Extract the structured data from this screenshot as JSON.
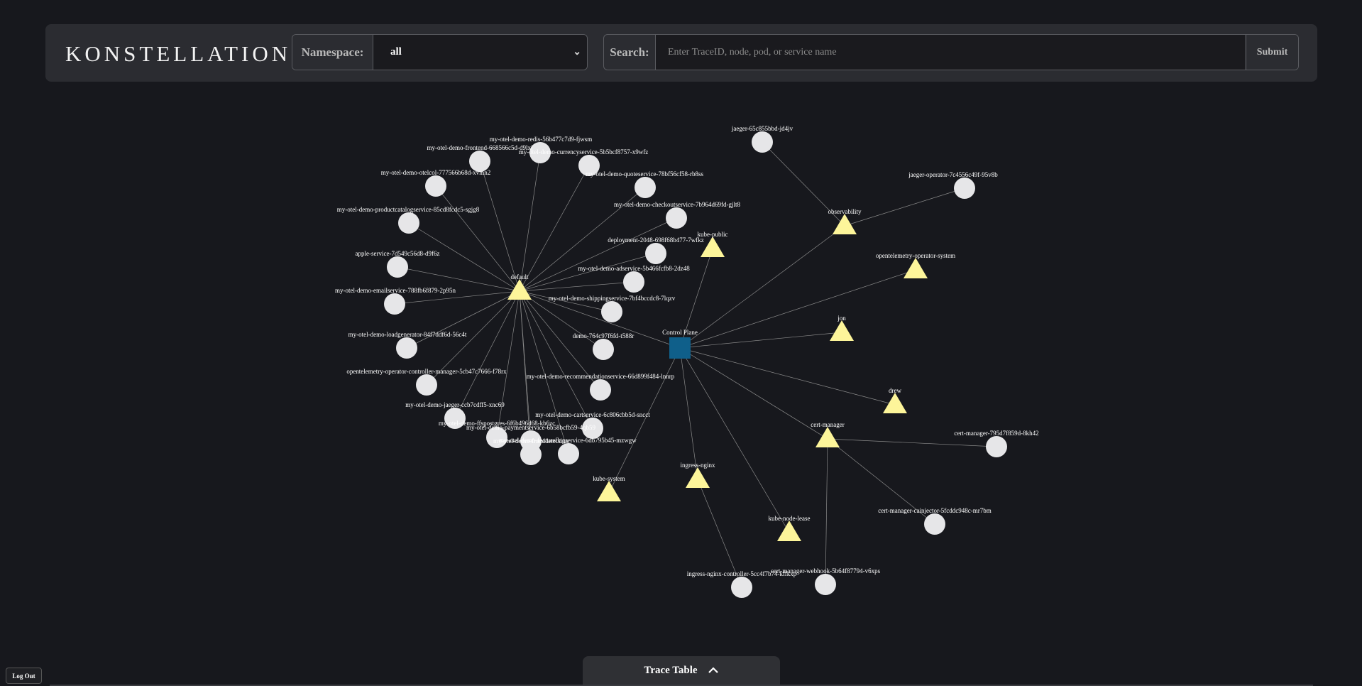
{
  "header": {
    "logo_text": "KONSTELLATION",
    "namespace_label": "Namespace:",
    "namespace_value": "all",
    "search_label": "Search:",
    "search_placeholder": "Enter TraceID, node, pod, or service name",
    "submit_label": "Submit"
  },
  "graph": {
    "colors": {
      "namespace": "#fdf59a",
      "pod": "#e6e6e8",
      "control_plane": "#0f5f8a",
      "edge": "#8a8a8a"
    },
    "control_plane": {
      "label": "Control Plane"
    },
    "namespaces": [
      {
        "label": "default",
        "pods": [
          "my-otel-demo-redis-56b477c7d9-fjwsm",
          "my-otel-demo-frontend-668566c5d-d9lxj",
          "my-otel-demo-currencyservice-5b5bcf8757-x9wfz",
          "my-otel-demo-quoteservice-78bf56cf58-rb8ss",
          "my-otel-demo-otelcol-777566b68d-xvmn2",
          "my-otel-demo-productcatalogservice-85cd8fcdc5-sgjg8",
          "my-otel-demo-checkoutservice-7b964d69fd-gjlt8",
          "deployment-2048-698f68b477-7wfkz",
          "apple-service-7d549c56d8-d9f6z",
          "my-otel-demo-adservice-5b466fcfb8-2dz48",
          "my-otel-demo-emailservice-788fb6f879-2p95n",
          "my-otel-demo-shippingservice-7bf4bccdc8-7lqzv",
          "my-otel-demo-loadgenerator-84f7ddf6d-56c4t",
          "demo-764c97f6fd-t588r",
          "opentelemetry-operator-controller-manager-5cb47c7666-f78rx",
          "my-otel-demo-recommendationservice-66d899f484-lnnrp",
          "my-otel-demo-jaeger-ccb7cdff5-xnc69",
          "my-otel-demo-cartservice-6c806cbb5d-sncct",
          "my-otel-demo-ffspostgres-6f6b496d68-kb6zc",
          "my-otel-demo-paymentservice-6b58bcfb59-4qb59",
          "my-otel-demo-featureflagservice-6db795b45-mzwgw",
          "my-otel-demo-frauddetection"
        ]
      },
      {
        "label": "observability",
        "pods": [
          "jaeger-65c855bbd-jd4jv",
          "jaeger-operator-7c4556c49f-95v8b"
        ]
      },
      {
        "label": "kube-public",
        "pods": []
      },
      {
        "label": "opentelemetry-operator-system",
        "pods": []
      },
      {
        "label": "jon",
        "pods": []
      },
      {
        "label": "drew",
        "pods": []
      },
      {
        "label": "cert-manager",
        "pods": [
          "cert-manager-795d7f859d-8kh42",
          "cert-manager-cainjector-5fcddc948c-mr7bm",
          "cert-manager-webhook-5b64f87794-v6xps"
        ]
      },
      {
        "label": "kube-node-lease",
        "pods": []
      },
      {
        "label": "ingress-nginx",
        "pods": [
          "ingress-nginx-controller-5cc4f7b74-kffkxp"
        ]
      },
      {
        "label": "kube-system",
        "pods": []
      }
    ]
  },
  "trace_table": {
    "label": "Trace Table"
  },
  "logout": {
    "label": "Log Out"
  }
}
